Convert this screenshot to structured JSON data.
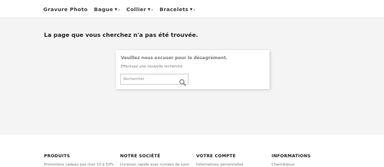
{
  "nav": {
    "items": [
      {
        "label": "Gravure Photo",
        "caret": false,
        "chevron": false
      },
      {
        "label": "Bague",
        "caret": true,
        "chevron": true
      },
      {
        "label": "Collier",
        "caret": true,
        "chevron": true
      },
      {
        "label": "Bracelets",
        "caret": true,
        "chevron": true
      }
    ]
  },
  "main": {
    "title": "La page que vous cherchez n'a pas été trouvée.",
    "card": {
      "heading": "Veuillez nous excuser pour le désagrément.",
      "subtext": "Effectuez une nouvelle recherche",
      "search": {
        "placeholder": "Rechercher",
        "value": ""
      },
      "search_icon": "search-icon"
    }
  },
  "footer": {
    "columns": [
      {
        "title": "PRODUITS",
        "link": "Promotions cadeau pas cher 10 à 50%"
      },
      {
        "title": "NOTRE SOCIÉTÉ",
        "link": "Livraison rapide avec numéro de suivi"
      },
      {
        "title": "VOTRE COMPTE",
        "link": "Informations personnelles"
      },
      {
        "title": "INFORMATIONS",
        "link": "Charmbijoux"
      }
    ]
  },
  "colors": {
    "main_bg": "#f4f4f4",
    "text": "#232323",
    "muted": "#7a7a7a"
  }
}
